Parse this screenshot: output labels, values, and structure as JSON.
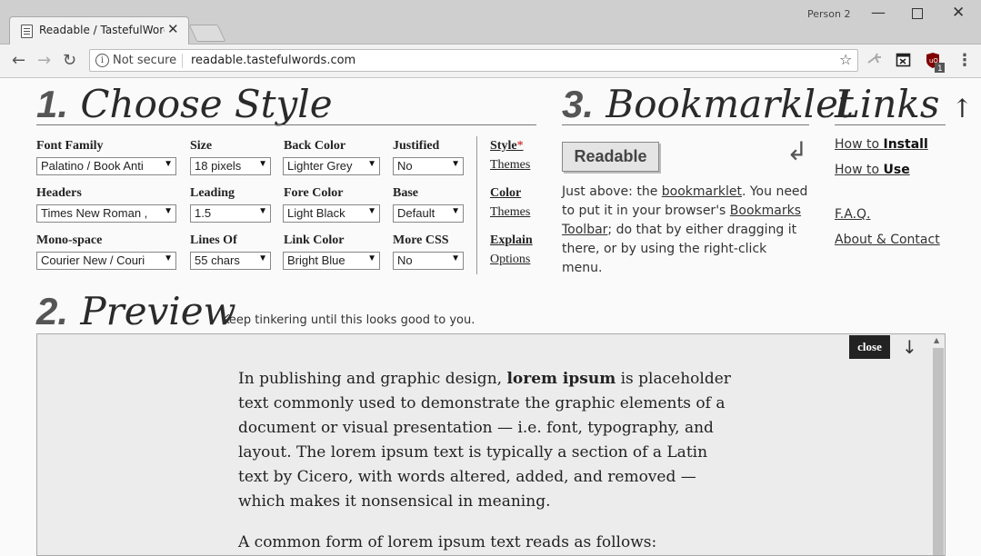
{
  "browser": {
    "tab_title": "Readable / TastefulWords",
    "profile": "Person 2",
    "security_label": "Not secure",
    "url": "readable.tastefulwords.com",
    "extension_badge": "1"
  },
  "choose_style": {
    "number": "1.",
    "title": "Choose Style",
    "fields": [
      {
        "label": "Font Family",
        "value": "Palatino / Book Anti"
      },
      {
        "label": "Size",
        "value": "18 pixels"
      },
      {
        "label": "Back Color",
        "value": "Lighter Grey"
      },
      {
        "label": "Justified",
        "value": "No"
      },
      {
        "label": "Headers",
        "value": "Times New Roman ,"
      },
      {
        "label": "Leading",
        "value": "1.5"
      },
      {
        "label": "Fore Color",
        "value": "Light Black"
      },
      {
        "label": "Base",
        "value": "Default"
      },
      {
        "label": "Mono-space",
        "value": "Courier New / Couri"
      },
      {
        "label": "Lines Of",
        "value": "55 chars"
      },
      {
        "label": "Link Color",
        "value": "Bright Blue"
      },
      {
        "label": "More CSS",
        "value": "No"
      }
    ],
    "side_links": [
      {
        "line1": "Style",
        "mark": "*",
        "line2": "Themes"
      },
      {
        "line1": "Color",
        "line2": "Themes"
      },
      {
        "line1": "Explain",
        "line2": "Options"
      }
    ]
  },
  "bookmarklet": {
    "number": "3.",
    "title": "Bookmarklet",
    "button_label": "Readable",
    "text_before_link": "Just above: the ",
    "link1": "bookmarklet",
    "text_mid": ". You need to put it in your browser's ",
    "link2": "Bookmarks Toolbar",
    "text_after": "; do that by either dragging it there, or by using the right-click menu."
  },
  "links": {
    "title": "Links",
    "arrow": "↑",
    "install_prefix": "How to ",
    "install_bold": "Install",
    "use_prefix": "How to ",
    "use_bold": "Use",
    "faq": "F.A.Q.",
    "about": "About & Contact"
  },
  "preview": {
    "number": "2.",
    "title": "Preview",
    "tagline": "Keep tinkering until this looks good to you.",
    "close_label": "close",
    "down_arrow": "↓",
    "p1_a": "In publishing and graphic design, ",
    "p1_bold": "lorem ipsum",
    "p1_b": " is placeholder text commonly used to demonstrate the graphic elements of a document or visual presentation — i.e. font, typography, and layout. The lorem ipsum text is typically a section of a Latin text by Cicero, with words altered, added, and removed — which makes it nonsensical in meaning.",
    "p2": "A common form of lorem ipsum text reads as follows:"
  }
}
